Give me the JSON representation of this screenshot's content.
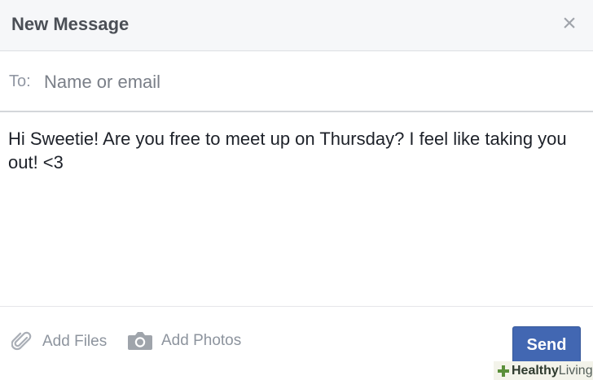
{
  "header": {
    "title": "New Message",
    "close_label": "×"
  },
  "to_field": {
    "label": "To:",
    "placeholder": "Name or email",
    "value": ""
  },
  "message": {
    "body": "Hi Sweetie! Are you free to meet up on Thursday? I feel like taking you out! <3"
  },
  "footer": {
    "add_files_label": "Add Files",
    "add_files_icon": "paperclip-icon",
    "add_photos_label": "Add Photos",
    "add_photos_icon": "camera-icon",
    "send_label": "Send"
  },
  "watermark": {
    "brand_bold": "Healthy",
    "brand_light": "Living"
  },
  "colors": {
    "header_bg": "#f6f7f9",
    "header_text": "#4b4f56",
    "send_bg": "#4267b2",
    "muted_text": "#8d949e"
  }
}
